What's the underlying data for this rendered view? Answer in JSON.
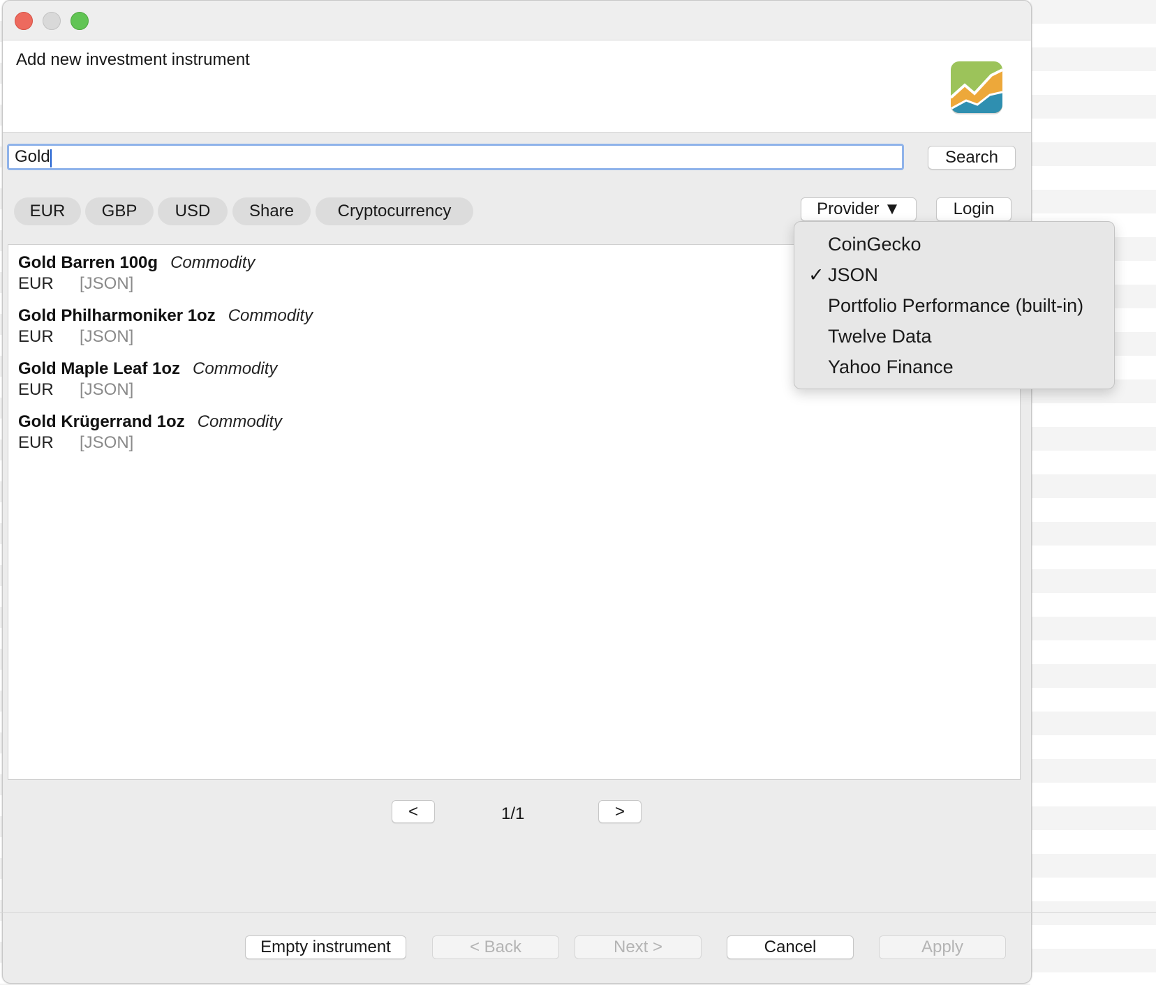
{
  "window": {
    "title": "Add new investment instrument"
  },
  "search": {
    "value": "Gold",
    "button_label": "Search"
  },
  "filters": [
    "EUR",
    "GBP",
    "USD",
    "Share",
    "Cryptocurrency"
  ],
  "provider_button_label": "Provider ▼",
  "login_label": "Login",
  "results": [
    {
      "name": "Gold Barren 100g",
      "type": "Commodity",
      "currency": "EUR",
      "source": "[JSON]"
    },
    {
      "name": "Gold Philharmoniker 1oz",
      "type": "Commodity",
      "currency": "EUR",
      "source": "[JSON]"
    },
    {
      "name": "Gold Maple Leaf 1oz",
      "type": "Commodity",
      "currency": "EUR",
      "source": "[JSON]"
    },
    {
      "name": "Gold Krügerrand 1oz",
      "type": "Commodity",
      "currency": "EUR",
      "source": "[JSON]"
    }
  ],
  "pagination": {
    "prev_label": "<",
    "page": "1/1",
    "next_label": ">"
  },
  "provider_menu": {
    "check_glyph": "✓",
    "items": [
      {
        "label": "CoinGecko",
        "checked": false
      },
      {
        "label": "JSON",
        "checked": true
      },
      {
        "label": "Portfolio Performance (built-in)",
        "checked": false
      },
      {
        "label": "Twelve Data",
        "checked": false
      },
      {
        "label": "Yahoo Finance",
        "checked": false
      }
    ]
  },
  "footer": {
    "empty_instrument": "Empty instrument",
    "back": "< Back",
    "next": "Next >",
    "cancel": "Cancel",
    "apply": "Apply"
  },
  "colors": {
    "focus_ring": "#8fb3ea",
    "close": "#ed6a5e",
    "minimize": "#d9d9d9",
    "maximize": "#61c454"
  },
  "icons": [
    "close-button",
    "minimize-button",
    "maximize-button",
    "app-logo-icon",
    "checkmark-icon"
  ]
}
